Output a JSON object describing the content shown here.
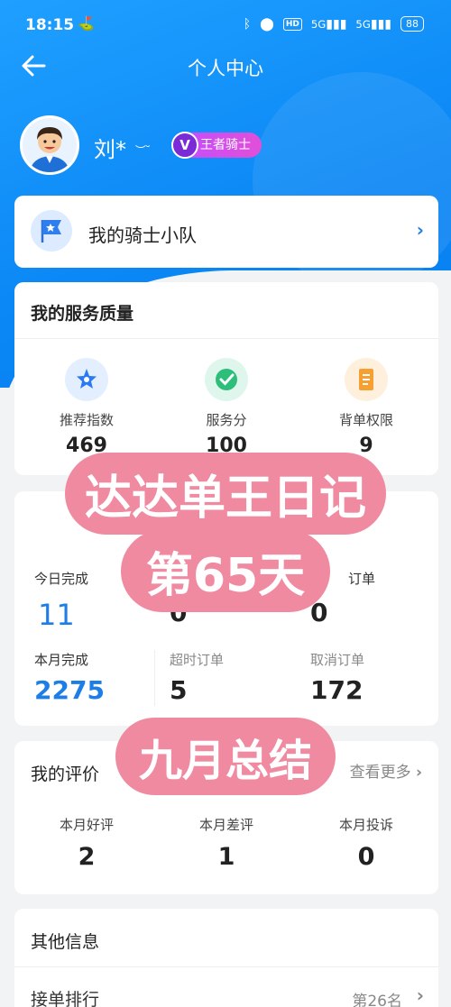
{
  "status": {
    "time": "18:15",
    "battery": "88",
    "hd": "HD",
    "net1": "5G",
    "net2": "5G"
  },
  "nav": {
    "title": "个人中心"
  },
  "profile": {
    "name": "刘*",
    "badge_v": "V",
    "badge_label": "王者骑士"
  },
  "team": {
    "label": "我的骑士小队"
  },
  "quality": {
    "title": "我的服务质量",
    "items": [
      {
        "label": "推荐指数",
        "value": "469",
        "icon": "star-shield-icon"
      },
      {
        "label": "服务分",
        "value": "100",
        "icon": "check-circle-icon"
      },
      {
        "label": "背单权限",
        "value": "9",
        "icon": "document-icon"
      }
    ]
  },
  "orders": {
    "today_label": "今日完成",
    "today_value": "11",
    "col2_value_today": "0",
    "col3_label_partial": "订单",
    "col3_value_today": "0",
    "month_label": "本月完成",
    "month_value": "2275",
    "overtime_label": "超时订单",
    "overtime_value": "5",
    "cancel_label": "取消订单",
    "cancel_value": "172"
  },
  "evals": {
    "title_partial": "我的评价",
    "more": "查看更多",
    "items": [
      {
        "label": "本月好评",
        "value": "2"
      },
      {
        "label": "本月差评",
        "value": "1"
      },
      {
        "label": "本月投诉",
        "value": "0"
      }
    ]
  },
  "other": {
    "title": "其他信息",
    "row_label": "接单排行",
    "row_value": "第26名"
  },
  "overlay": {
    "line1": "达达单王日记",
    "line2": "第65天",
    "line3": "九月总结"
  },
  "colors": {
    "primary": "#0a86f5",
    "overlay_pink": "#f08aa0",
    "badge": "#c04fff"
  }
}
